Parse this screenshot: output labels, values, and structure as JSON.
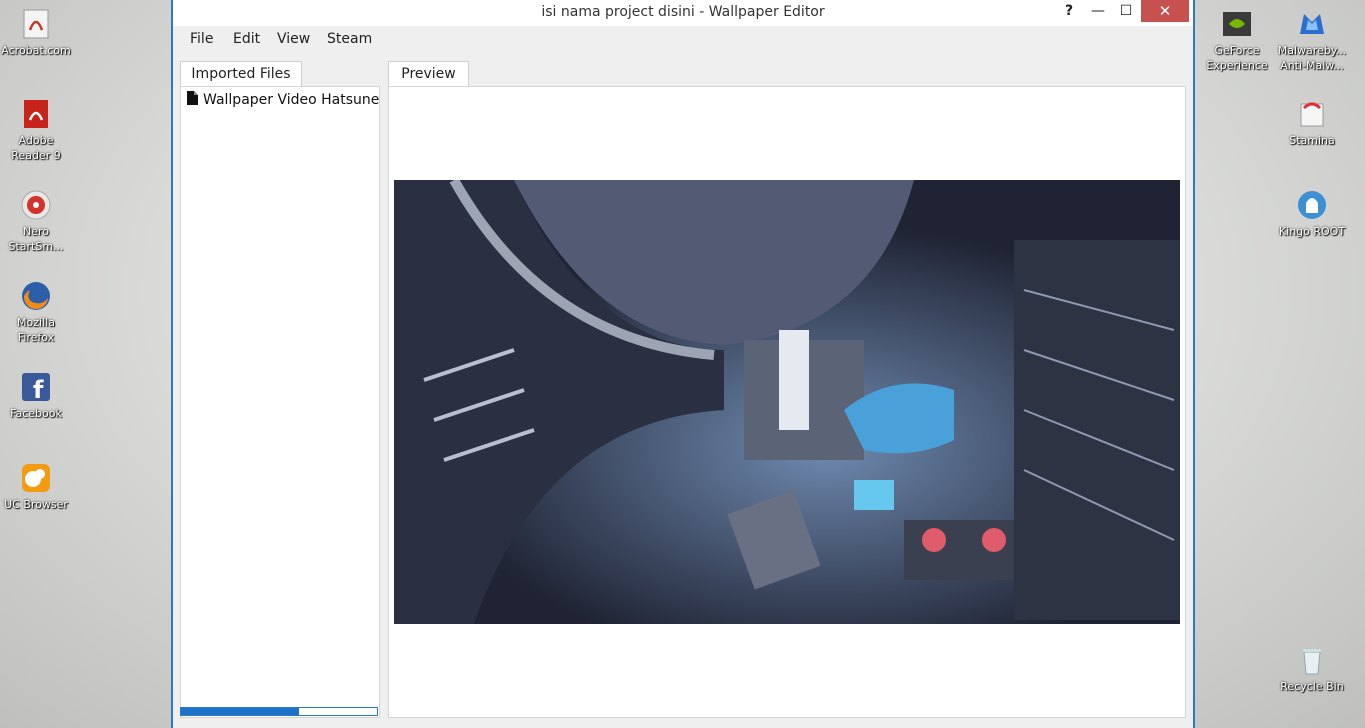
{
  "desktop": {
    "left_icons": [
      {
        "label": "Acrobat.com",
        "icon": "acrobat-icon"
      },
      {
        "label": "Adobe Reader 9",
        "icon": "pdf-reader-icon"
      },
      {
        "label": "Nero StartSm...",
        "icon": "nero-icon"
      },
      {
        "label": "Mozilla Firefox",
        "icon": "firefox-icon"
      },
      {
        "label": "Facebook",
        "icon": "facebook-icon"
      },
      {
        "label": "UC Browser",
        "icon": "uc-browser-icon"
      }
    ],
    "right_icons": [
      {
        "label": "GeForce Experience",
        "icon": "geforce-icon"
      },
      {
        "label": "Malwareby... Anti-Malw...",
        "icon": "malwarebytes-icon"
      },
      {
        "label": "Stamina",
        "icon": "stamina-icon"
      },
      {
        "label": "Kingo ROOT",
        "icon": "kingo-root-icon"
      },
      {
        "label": "Recycle Bin",
        "icon": "recycle-bin-icon"
      }
    ]
  },
  "window": {
    "title": "isi nama project disini - Wallpaper Editor",
    "help_label": "?",
    "minimize_label": "—",
    "maximize_label": "☐",
    "close_label": "✕"
  },
  "menu": [
    "File",
    "Edit",
    "View",
    "Steam"
  ],
  "left_panel": {
    "tab_label": "Imported Files",
    "files": [
      {
        "name": "Wallpaper Video Hatsune m",
        "icon": "document-icon"
      }
    ],
    "progress": 0.6
  },
  "preview": {
    "tab_label": "Preview"
  }
}
